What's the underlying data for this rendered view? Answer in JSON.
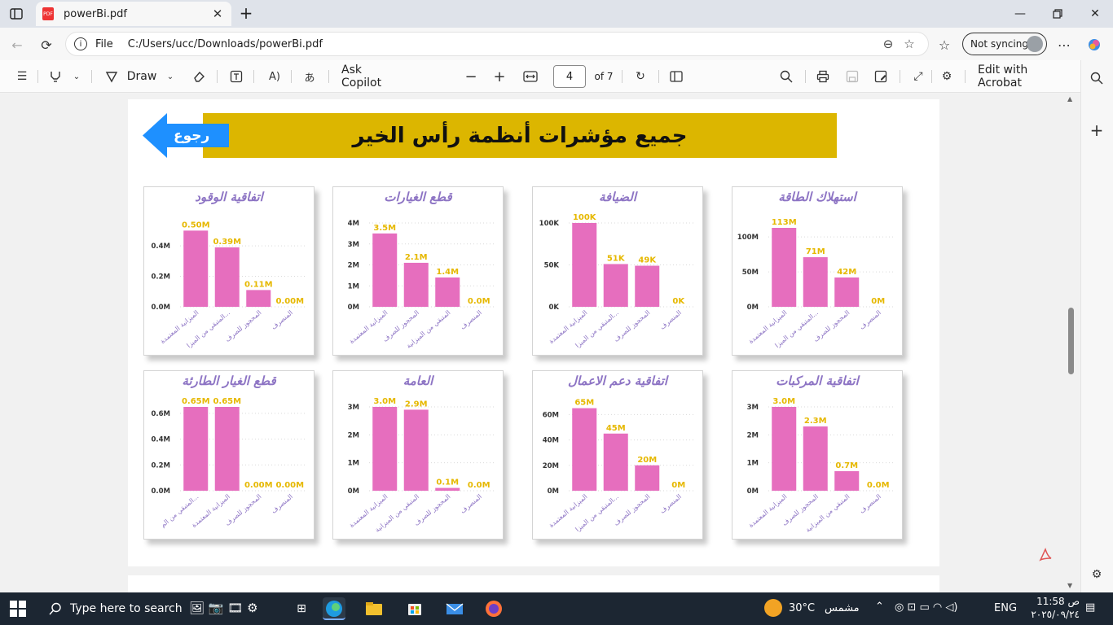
{
  "browser": {
    "tab_title": "powerBi.pdf",
    "tab_badge": "PDF",
    "address_label": "File",
    "url": "C:/Users/ucc/Downloads/powerBi.pdf",
    "sync_label": "Not syncing"
  },
  "toolbar": {
    "draw_label": "Draw",
    "copilot_label": "Ask Copilot",
    "page_current": "4",
    "page_total": "of 7",
    "acrobat_label": "Edit with Acrobat"
  },
  "report": {
    "title": "جميع مؤشرات أنظمة رأس الخير",
    "back_label": "رجوع",
    "colors": {
      "banner": "#dcb600",
      "bar": "#e66ebe",
      "value_label": "#e6b800",
      "title": "#8d74c4",
      "axis_text": "#333333",
      "category_text": "#8d74c4",
      "back_arrow": "#1e90ff"
    },
    "cards": [
      {
        "title": "استهلاك الطاقة",
        "yticks": [
          "100M",
          "50M",
          "0M"
        ],
        "chart_data": {
          "type": "bar",
          "categories": [
            "الميزانية المعتمدة",
            "المتبقي من الميزا...",
            "المحجوز للصرف",
            "المنصرف"
          ],
          "values": [
            113,
            71,
            42,
            0
          ],
          "value_labels": [
            "113M",
            "71M",
            "42M",
            "0M"
          ],
          "ylim": [
            0,
            120
          ],
          "tick_values": [
            100,
            50,
            0
          ]
        }
      },
      {
        "title": "الضيافة",
        "yticks": [
          "100K",
          "50K",
          "0K"
        ],
        "chart_data": {
          "type": "bar",
          "categories": [
            "الميزانية المعتمدة",
            "المتبقي من الميزا...",
            "المحجوز للصرف",
            "المنصرف"
          ],
          "values": [
            100,
            51,
            49,
            0
          ],
          "value_labels": [
            "100K",
            "51K",
            "49K",
            "0K"
          ],
          "ylim": [
            0,
            100
          ],
          "tick_values": [
            100,
            50,
            0
          ]
        }
      },
      {
        "title": "قطع الغيارات",
        "yticks": [
          "4M",
          "3M",
          "2M",
          "1M",
          "0M"
        ],
        "chart_data": {
          "type": "bar",
          "categories": [
            "الميزانية المعتمدة",
            "المحجوز للصرف",
            "المتبقي من الميزانية",
            "المنصرف"
          ],
          "values": [
            3.5,
            2.1,
            1.4,
            0
          ],
          "value_labels": [
            "3.5M",
            "2.1M",
            "1.4M",
            "0.0M"
          ],
          "ylim": [
            0,
            4
          ],
          "tick_values": [
            4,
            3,
            2,
            1,
            0
          ]
        }
      },
      {
        "title": "اتفاقية الوقود",
        "yticks": [
          "0.4M",
          "0.2M",
          "0.0M"
        ],
        "chart_data": {
          "type": "bar",
          "categories": [
            "الميزانية المعتمدة",
            "المتبقي من الميزا...",
            "المحجوز للصرف",
            "المنصرف"
          ],
          "values": [
            0.5,
            0.39,
            0.11,
            0
          ],
          "value_labels": [
            "0.50M",
            "0.39M",
            "0.11M",
            "0.00M"
          ],
          "ylim": [
            0,
            0.55
          ],
          "tick_values": [
            0.4,
            0.2,
            0
          ]
        }
      },
      {
        "title": "اتفاقية المركبات",
        "yticks": [
          "3M",
          "2M",
          "1M",
          "0M"
        ],
        "chart_data": {
          "type": "bar",
          "categories": [
            "الميزانية المعتمدة",
            "المحجوز للصرف",
            "المتبقي من الميزانية",
            "المنصرف"
          ],
          "values": [
            3.0,
            2.3,
            0.7,
            0
          ],
          "value_labels": [
            "3.0M",
            "2.3M",
            "0.7M",
            "0.0M"
          ],
          "ylim": [
            0,
            3
          ],
          "tick_values": [
            3,
            2,
            1,
            0
          ]
        }
      },
      {
        "title": "اتفاقية دعم الاعمال",
        "yticks": [
          "60M",
          "40M",
          "20M",
          "0M"
        ],
        "chart_data": {
          "type": "bar",
          "categories": [
            "الميزانية المعتمدة",
            "المتبقي من الميزا...",
            "المحجوز للصرف",
            "المنصرف"
          ],
          "values": [
            65,
            45,
            20,
            0
          ],
          "value_labels": [
            "65M",
            "45M",
            "20M",
            "0M"
          ],
          "ylim": [
            0,
            66
          ],
          "tick_values": [
            60,
            40,
            20,
            0
          ]
        }
      },
      {
        "title": "العامة",
        "yticks": [
          "3M",
          "2M",
          "1M",
          "0M"
        ],
        "chart_data": {
          "type": "bar",
          "categories": [
            "الميزانية المعتمدة",
            "المتبقي من الميزانية",
            "المحجوز للصرف",
            "المنصرف"
          ],
          "values": [
            3.0,
            2.9,
            0.1,
            0
          ],
          "value_labels": [
            "3.0M",
            "2.9M",
            "0.1M",
            "0.0M"
          ],
          "ylim": [
            0,
            3
          ],
          "tick_values": [
            3,
            2,
            1,
            0
          ]
        }
      },
      {
        "title": "قطع الغيار الطارئة",
        "yticks": [
          "0.6M",
          "0.4M",
          "0.2M",
          "0.0M"
        ],
        "chart_data": {
          "type": "bar",
          "categories": [
            "المتبقي من الم...",
            "الميزانية المعتمدة",
            "المحجوز للصرف",
            "المنصرف"
          ],
          "values": [
            0.65,
            0.65,
            0,
            0
          ],
          "value_labels": [
            "0.65M",
            "0.65M",
            "0.00M",
            "0.00M"
          ],
          "ylim": [
            0,
            0.65
          ],
          "tick_values": [
            0.6,
            0.4,
            0.2,
            0
          ]
        }
      }
    ]
  },
  "taskbar": {
    "search_placeholder": "Type here to search",
    "temperature": "30°C",
    "weather": "مشمس",
    "language": "ENG",
    "time": "11:58 ص",
    "date": "٢٠٢٥/٠٩/٢٤"
  }
}
